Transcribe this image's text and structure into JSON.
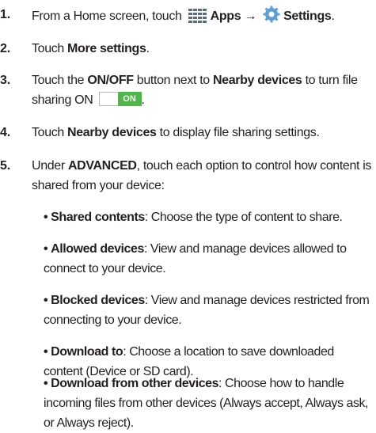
{
  "steps": [
    {
      "num": "1.",
      "pre": "From a Home screen, touch ",
      "apps": "Apps",
      "arrow": " → ",
      "settings": "Settings",
      "end": "."
    },
    {
      "num": "2.",
      "pre": "Touch ",
      "bold": "More settings",
      "end": "."
    },
    {
      "num": "3.",
      "pre": "Touch the ",
      "bold1": "ON/OFF",
      "mid": " button next to ",
      "bold2": "Nearby devices",
      "post": " to turn file sharing ON ",
      "toggle_label": "ON",
      "end": "."
    },
    {
      "num": "4.",
      "pre": "Touch ",
      "bold": "Nearby devices",
      "post": " to display file sharing settings."
    },
    {
      "num": "5.",
      "pre": "Under ",
      "bold": "ADVANCED",
      "post": ", touch each option to control how content is shared from your device:"
    }
  ],
  "options": [
    {
      "label": "Shared contents",
      "desc": ": Choose the type of content to share."
    },
    {
      "label": "Allowed devices",
      "desc": ": View and manage devices allowed to connect to your device."
    },
    {
      "label": "Blocked devices",
      "desc": ": View and manage devices restricted from connecting to your device."
    },
    {
      "label": "Download to",
      "desc": ": Choose a location to save downloaded content (Device or SD card)."
    },
    {
      "label": "Download from other devices",
      "desc": ": Choose how to handle incoming files from other devices (Always accept, Always ask, or Always reject)."
    }
  ],
  "bullet_char": "•",
  "icons": {
    "apps": "apps-grid-icon",
    "settings": "gear-icon"
  },
  "colors": {
    "toggle_on": "#4db848",
    "apps_icon": "#5a6b7a",
    "settings_icon": "#5b9fd6"
  }
}
